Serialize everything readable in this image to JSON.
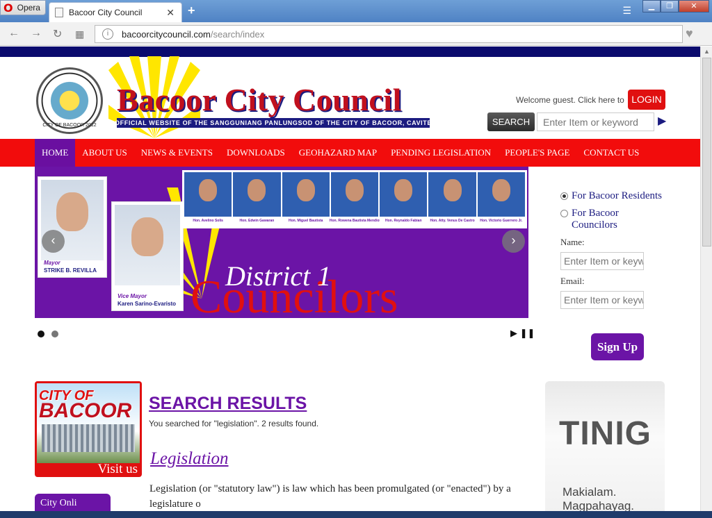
{
  "browser": {
    "opera_label": "Opera",
    "tab_title": "Bacoor City Council",
    "url_host": "bacoorcitycouncil.com",
    "url_path": "/search/index"
  },
  "header": {
    "title": "Bacoor City Council",
    "subtitle": "OFFICIAL WEBSITE OF THE SANGGUNIANG PANLUNGSOD OF THE CITY OF BACOOR, CAVITE",
    "seal_text": "CITY OF BACOOR 2012",
    "welcome": "Welcome guest. Click here to",
    "login": "LOGIN",
    "search_button": "SEARCH",
    "search_placeholder": "Enter Item or keyword"
  },
  "nav": {
    "items": [
      {
        "label": "HOME"
      },
      {
        "label": "ABOUT US"
      },
      {
        "label": "NEWS & EVENTS"
      },
      {
        "label": "DOWNLOADS"
      },
      {
        "label": "GEOHAZARD MAP"
      },
      {
        "label": "PENDING LEGISLATION"
      },
      {
        "label": "PEOPLE'S PAGE"
      },
      {
        "label": "CONTACT US"
      }
    ]
  },
  "slider": {
    "mayor_role": "Mayor",
    "mayor_name": "STRIKE B. REVILLA",
    "vice_role": "Vice Mayor",
    "vice_name": "Karen Sarino-Evaristo",
    "councilors": [
      "Hon. Avelino Solis",
      "Hon. Edwin Gawaran",
      "Hon. Miguel Bautista",
      "Hon. Rowena Bautista Mendiola",
      "Hon. Reynaldo Fabian",
      "Hon. Atty. Venus De Castro",
      "Hon. Victorio Guerrero Jr."
    ],
    "district": "District 1",
    "councilors_word": "Councilors"
  },
  "signup": {
    "option1": "For Bacoor Residents",
    "option2": "For Bacoor Councilors",
    "name_label": "Name:",
    "name_placeholder": "Enter Item or keyw",
    "email_label": "Email:",
    "email_placeholder": "Enter Item or keyw",
    "button": "Sign Up"
  },
  "visit": {
    "city": "CITY OF",
    "bacoor": "BACOOR",
    "visit_us": "Visit us"
  },
  "city_online": "City Onli",
  "results": {
    "heading": "SEARCH RESULTS",
    "summary": "You searched for \"legislation\". 2 results found.",
    "item_title": "Legislation",
    "item_text": "Legislation (or \"statutory law\") is law which has been promulgated (or \"enacted\") by a legislature o"
  },
  "tinig": {
    "title": "TINIG",
    "line1": "Makialam.",
    "line2": "Magpahayag."
  }
}
